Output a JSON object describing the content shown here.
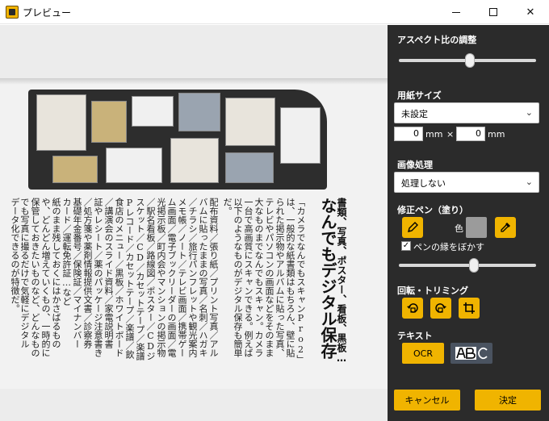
{
  "window": {
    "title": "プレビュー",
    "controls": {
      "minimize": "minimize",
      "maximize": "maximize",
      "close": "✕"
    }
  },
  "preview": {
    "headline": "なんでもデジタル保存",
    "subhead": "書類、写真、ポスター、看板、黒板…",
    "columns": [
      "「カメラでなんでもスキャンPro2」",
      "は、一般的な紙書類はもちろん、壁に貼",
      "られた掲示物やアルバムに貼った写真、",
      "テレビやパソコンの画面などをそのまま",
      "大なものまでなんでもスキャン。カメラ",
      "一台で高画質にスキャンできる。例えば",
      "以下のようなものがデジタル保存も簡単",
      "だ。",
      "配布資料／張り紙／プリント写真／アル",
      "バムに貼ったままの写真／名刺／ハガキ",
      "／チラシ／旅行パンフレットや観光案内",
      "メモ帳／ノート／テレビ画面／携帯ゲー",
      "ム画面／電子ブックリーダーの画面／電",
      "光掲示板／町内会やマンションの掲示物",
      "／駅名看板／路線図／ポスター／CDジ",
      "スケット／CD／カセットテープ／楽譜",
      "Pレコード／カセットテープ／楽譜／飲",
      "食店のメニュー／黒板／ホワイトボード",
      "／講演会のスライド資料／家電説明書",
      "証やレシート／薬のパッケージ注意書き",
      "／処方箋や薬剤情報提供文書／診察券",
      "基礎年金番号／保険証／マイナンバー",
      "カード／運転免許証…など",
      "紙のまま残しておくにはかさばるもの",
      "や、どんどん増えていくもの、一時的に",
      "保管しておきたいものなど、どんなもの",
      "でも写真に撮るだけで気軽にデジタル",
      "データ化できるのが特徴だ。"
    ]
  },
  "aspect": {
    "title": "アスペクト比の調整",
    "level": 0.52
  },
  "paper": {
    "title": "用紙サイズ",
    "selected": "未設定",
    "width_value": "0",
    "height_value": "0",
    "unit": "mm",
    "times": "×"
  },
  "image_processing": {
    "title": "画像処理",
    "selected": "処理しない"
  },
  "pen": {
    "title": "修正ペン（塗り）",
    "color_label": "色",
    "blur_label": "ペンの縁をぼかす",
    "blur_checked": true,
    "level": 0.55
  },
  "rotate": {
    "title": "回転・トリミング"
  },
  "text": {
    "title": "テキスト",
    "ocr_label": "OCR"
  },
  "actions": {
    "cancel": "キャンセル",
    "ok": "決定"
  },
  "colors": {
    "accent": "#f0b400",
    "panel_bg": "#2b2b2b",
    "swatch": "#9b9b9b"
  },
  "icons": [
    "app-icon",
    "pen-icon",
    "eyedropper-icon",
    "rotate-left-icon",
    "rotate-right-icon",
    "crop-icon",
    "abc-text-icon",
    "check-icon",
    "chevron-down-icon"
  ]
}
